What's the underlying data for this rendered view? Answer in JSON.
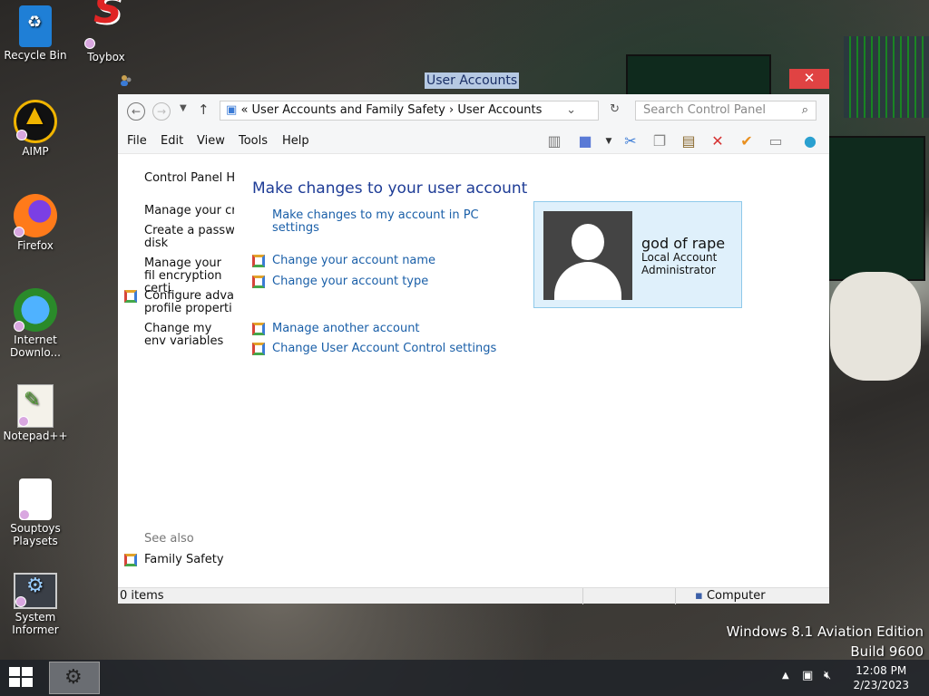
{
  "desktop": {
    "icons": [
      {
        "label": "Recycle Bin"
      },
      {
        "label": "Toybox"
      },
      {
        "label": "AIMP"
      },
      {
        "label": "Firefox"
      },
      {
        "label": "Internet Downlo..."
      },
      {
        "label": "Notepad++"
      },
      {
        "label": "Souptoys Playsets"
      },
      {
        "label": "System Informer"
      }
    ],
    "watermark": {
      "line1": "Windows 8.1 Aviation Edition",
      "line2": "Build 9600"
    }
  },
  "window": {
    "title": "User Accounts",
    "close_glyph": "✕",
    "address": {
      "prefix": "«",
      "crumb1": "User Accounts and Family Safety",
      "sep": "›",
      "crumb2": "User Accounts"
    },
    "search_placeholder": "Search Control Panel",
    "menu": [
      "File",
      "Edit",
      "View",
      "Tools",
      "Help"
    ],
    "left_pane": {
      "items": [
        "Control Panel H",
        "Manage your cr",
        "Create a passw disk",
        "Manage your fil encryption certi",
        "Configure adva profile properti",
        "Change my env variables"
      ],
      "see_also": "See also",
      "family_safety": "Family Safety"
    },
    "main": {
      "title": "Make changes to your user account",
      "links": [
        "Make changes to my account in PC settings",
        "Change your account name",
        "Change your account type",
        "Manage another account",
        "Change User Account Control settings"
      ]
    },
    "user": {
      "name": "god of rape",
      "type": "Local Account",
      "role": "Administrator"
    },
    "status": {
      "items": "0 items",
      "location": "Computer"
    }
  },
  "taskbar": {
    "time": "12:08 PM",
    "date": "2/23/2023"
  }
}
